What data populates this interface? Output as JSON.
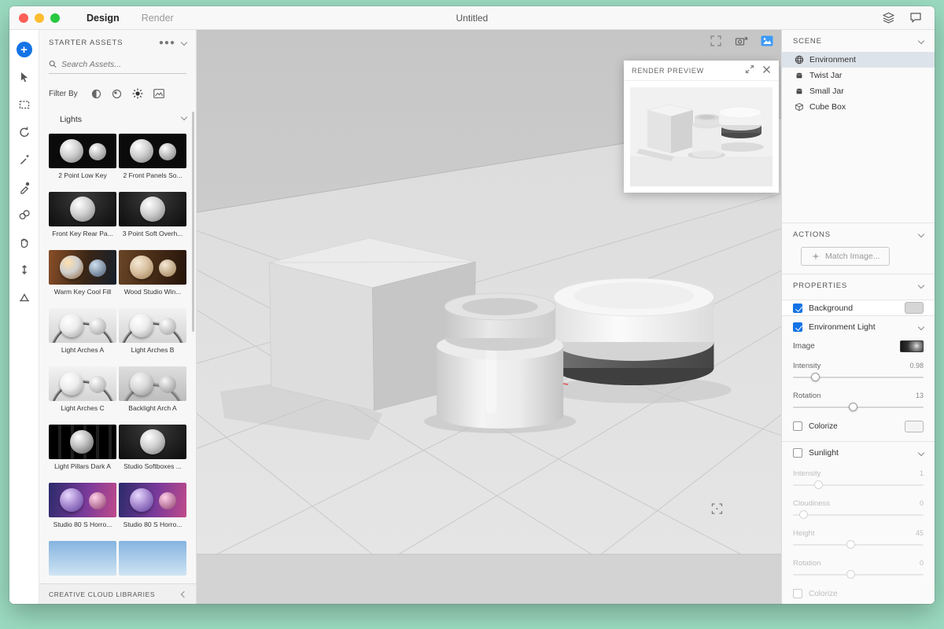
{
  "colors": {
    "accent": "#1473e6",
    "mint_background": "#9cdcc2",
    "selection": "#dde3ea"
  },
  "titlebar": {
    "tabs": [
      {
        "label": "Design"
      },
      {
        "label": "Render"
      }
    ],
    "title": "Untitled",
    "icons": [
      "layers-icon",
      "comment-icon"
    ]
  },
  "toolbar": {
    "tools": [
      "add",
      "select-move",
      "marquee",
      "orbit",
      "magic-wand",
      "eyedropper",
      "materials",
      "pan-hand",
      "dolly",
      "horizon"
    ]
  },
  "assets_panel": {
    "header": "STARTER ASSETS",
    "menu_icon": "ellipsis-icon",
    "search_placeholder": "Search Assets...",
    "filter_label": "Filter By",
    "filters": [
      "models-filter-icon",
      "materials-filter-icon",
      "lights-filter-icon",
      "images-filter-icon"
    ],
    "section_label": "Lights",
    "items": [
      {
        "label": "2 Point Low Key",
        "variant": "dark-two"
      },
      {
        "label": "2 Front Panels So...",
        "variant": "dark-two"
      },
      {
        "label": "Front Key Rear Pa...",
        "variant": "dark-one"
      },
      {
        "label": "3 Point Soft Overh...",
        "variant": "dark-one"
      },
      {
        "label": "Warm Key Cool Fill",
        "variant": "warm"
      },
      {
        "label": "Wood Studio Win...",
        "variant": "wood"
      },
      {
        "label": "Light Arches A",
        "variant": "light-arch"
      },
      {
        "label": "Light Arches B",
        "variant": "light-arch"
      },
      {
        "label": "Light Arches C",
        "variant": "light-arch"
      },
      {
        "label": "Backlight Arch A",
        "variant": "gray-arch"
      },
      {
        "label": "Light Pillars Dark A",
        "variant": "dark-pillar"
      },
      {
        "label": "Studio Softboxes ...",
        "variant": "dark-one"
      },
      {
        "label": "Studio 80 S Horro...",
        "variant": "neon"
      },
      {
        "label": "Studio 80 S Horro...",
        "variant": "neon"
      },
      {
        "label": "",
        "variant": "sky"
      },
      {
        "label": "",
        "variant": "sky"
      }
    ],
    "footer": "CREATIVE CLOUD LIBRARIES"
  },
  "canvas": {
    "overlay_icons": [
      "fullscreen-icon",
      "camera-bookmark-icon",
      "image-icon",
      "region-select-icon"
    ]
  },
  "render_preview": {
    "title": "RENDER PREVIEW",
    "icons": [
      "expand-icon",
      "close-icon"
    ]
  },
  "scene_panel": {
    "header": "SCENE",
    "items": [
      {
        "label": "Environment",
        "icon": "globe-icon",
        "selected": true
      },
      {
        "label": "Twist Jar",
        "icon": "model-icon",
        "selected": false
      },
      {
        "label": "Small Jar",
        "icon": "model-icon",
        "selected": false
      },
      {
        "label": "Cube Box",
        "icon": "cube-icon",
        "selected": false
      }
    ]
  },
  "actions_panel": {
    "header": "ACTIONS",
    "match_image": "Match Image..."
  },
  "properties_panel": {
    "header": "PROPERTIES",
    "background": {
      "label": "Background",
      "checked": true
    },
    "environment_light": {
      "label": "Environment Light",
      "checked": true,
      "image_label": "Image",
      "intensity": {
        "label": "Intensity",
        "value": "0.98",
        "pct": 17
      },
      "rotation": {
        "label": "Rotation",
        "value": "13",
        "pct": 46
      },
      "colorize": {
        "label": "Colorize",
        "checked": false
      }
    },
    "sunlight": {
      "label": "Sunlight",
      "checked": false,
      "intensity": {
        "label": "Intensity",
        "value": "1",
        "pct": 19
      },
      "cloudiness": {
        "label": "Cloudiness",
        "value": "0",
        "pct": 8
      },
      "height": {
        "label": "Height",
        "value": "45",
        "pct": 44
      },
      "rotation": {
        "label": "Rotation",
        "value": "0",
        "pct": 44
      },
      "colorize": {
        "label": "Colorize",
        "checked": false
      }
    }
  }
}
